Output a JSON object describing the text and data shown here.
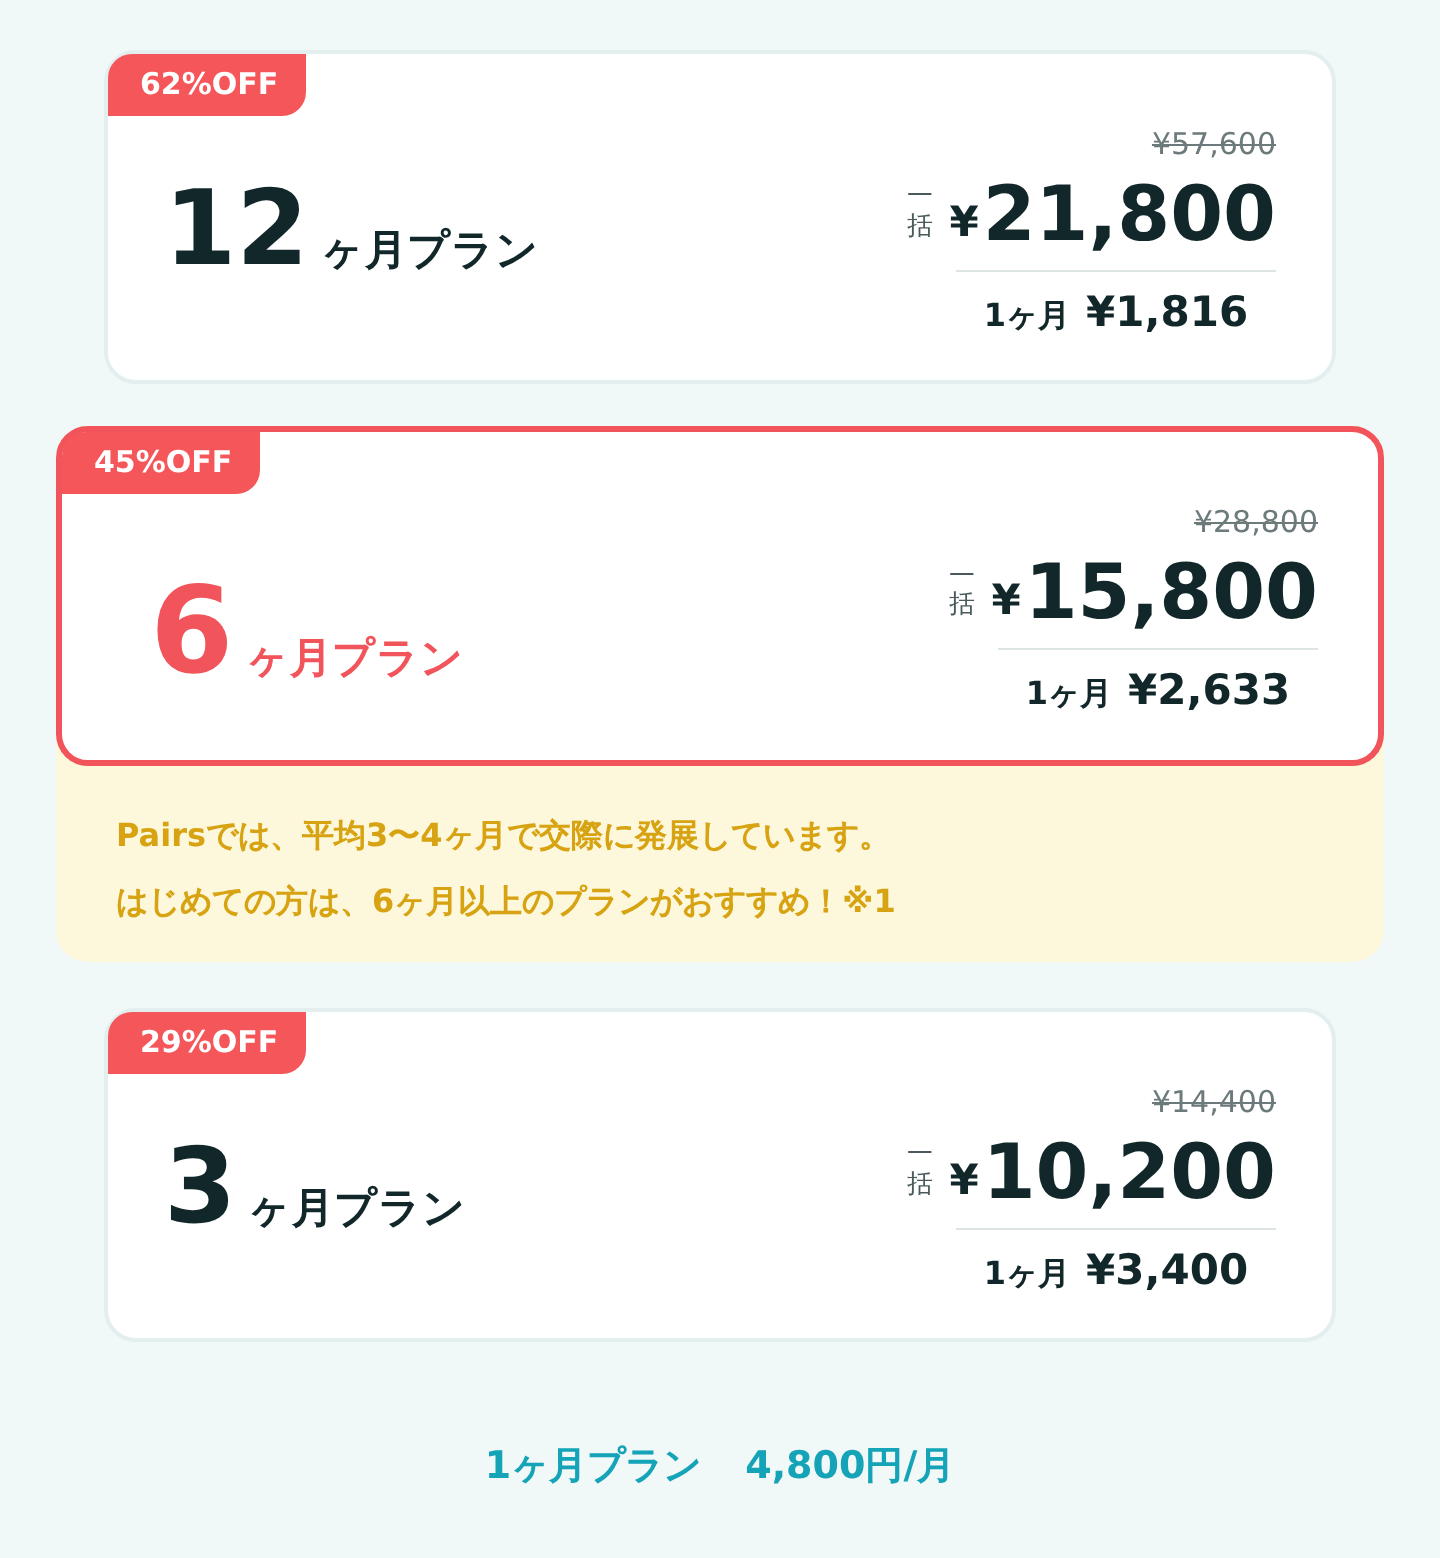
{
  "plans": [
    {
      "badge": "62%OFF",
      "months": "12",
      "unit": "ヶ月プラン",
      "selected": false,
      "original_price": "¥57,600",
      "lump_label": "一括",
      "currency": "¥",
      "price": "21,800",
      "monthly_label": "1ヶ月",
      "monthly_price": "¥1,816"
    },
    {
      "badge": "45%OFF",
      "months": "6",
      "unit": "ヶ月プラン",
      "selected": true,
      "original_price": "¥28,800",
      "lump_label": "一括",
      "currency": "¥",
      "price": "15,800",
      "monthly_label": "1ヶ月",
      "monthly_price": "¥2,633",
      "note": [
        "Pairsでは、平均3〜4ヶ月で交際に発展しています。",
        "はじめての方は、6ヶ月以上のプランがおすすめ！※1"
      ]
    },
    {
      "badge": "29%OFF",
      "months": "3",
      "unit": "ヶ月プラン",
      "selected": false,
      "original_price": "¥14,400",
      "lump_label": "一括",
      "currency": "¥",
      "price": "10,200",
      "monthly_label": "1ヶ月",
      "monthly_price": "¥3,400"
    }
  ],
  "monthly_link": {
    "label": "1ヶ月プラン",
    "price": "4,800円/月"
  }
}
